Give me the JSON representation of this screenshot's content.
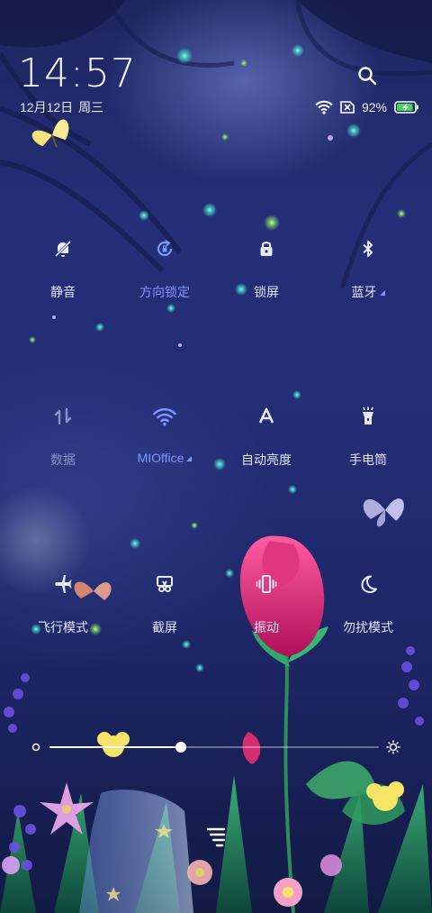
{
  "status": {
    "time": "14:57",
    "date": "12月12日",
    "weekday": "周三",
    "battery": "92%",
    "battery_level": 0.92
  },
  "toggles": [
    {
      "id": "silent",
      "label": "静音",
      "icon": "bell-off-icon",
      "state": "off"
    },
    {
      "id": "rotation-lock",
      "label": "方向锁定",
      "icon": "rotation-lock-icon",
      "state": "on"
    },
    {
      "id": "lock-screen",
      "label": "锁屏",
      "icon": "lock-icon",
      "state": "off"
    },
    {
      "id": "bluetooth",
      "label": "蓝牙",
      "icon": "bluetooth-icon",
      "state": "off"
    },
    {
      "id": "mobile-data",
      "label": "数据",
      "icon": "data-arrows-icon",
      "state": "disabled"
    },
    {
      "id": "wifi",
      "label": "MIOffice",
      "icon": "wifi-icon",
      "state": "on"
    },
    {
      "id": "auto-brightness",
      "label": "自动亮度",
      "icon": "auto-brightness-icon",
      "state": "off"
    },
    {
      "id": "flashlight",
      "label": "手电筒",
      "icon": "flashlight-icon",
      "state": "off"
    },
    {
      "id": "airplane",
      "label": "飞行模式",
      "icon": "airplane-icon",
      "state": "off"
    },
    {
      "id": "screenshot",
      "label": "截屏",
      "icon": "scissors-icon",
      "state": "off"
    },
    {
      "id": "vibrate",
      "label": "振动",
      "icon": "vibrate-icon",
      "state": "off"
    },
    {
      "id": "dnd",
      "label": "勿扰模式",
      "icon": "moon-icon",
      "state": "off"
    }
  ],
  "brightness": {
    "level": 0.4
  },
  "colors": {
    "accent": "#7f96ff",
    "text": "#e4e7ff",
    "disabled": "#8c93c2",
    "background": "#232d74"
  }
}
